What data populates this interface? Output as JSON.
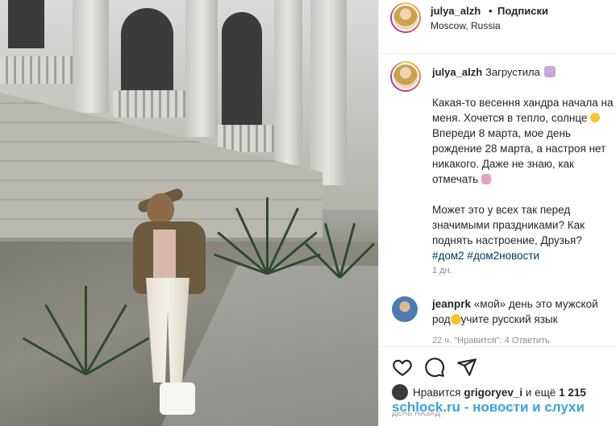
{
  "post": {
    "header": {
      "username": "julya_alzh",
      "separator": "•",
      "follow_label": "Подписки",
      "location": "Moscow, Russia"
    },
    "caption": {
      "username": "julya_alzh",
      "mood": "Загрустила",
      "paragraph1": "Какая-то весення хандра начала на меня. Хочется в тепло, солнце",
      "paragraph1b": "Впереди 8 марта, мое день рождение 28 марта, а настроя нет никакого. Даже не знаю, как отмечать",
      "paragraph2": "Может это у всех так перед значимыми праздниками? Как поднять настроение, Друзья?",
      "hashtags": "#дом2 #дом2новости",
      "time_ago": "1 дн."
    },
    "comment": {
      "username": "jeanprk",
      "text": "«мой» день это мужской род",
      "text2": "учите русский язык",
      "meta": "22 ч.    \"Нравится\": 4    Ответить"
    },
    "likes": {
      "prefix": "Нравится",
      "user": "grigoryev_i",
      "middle": "и ещё",
      "count": "1 215"
    },
    "date_label": "ДЕНЬ НАЗАД",
    "watermark": "schlock.ru - новости и слухи"
  },
  "icons": [
    "heart-icon",
    "comment-icon",
    "share-icon"
  ],
  "colors": {
    "link": "#00376b",
    "muted": "#8e8e8e",
    "text": "#262626",
    "watermark": "#3aa3d9"
  }
}
